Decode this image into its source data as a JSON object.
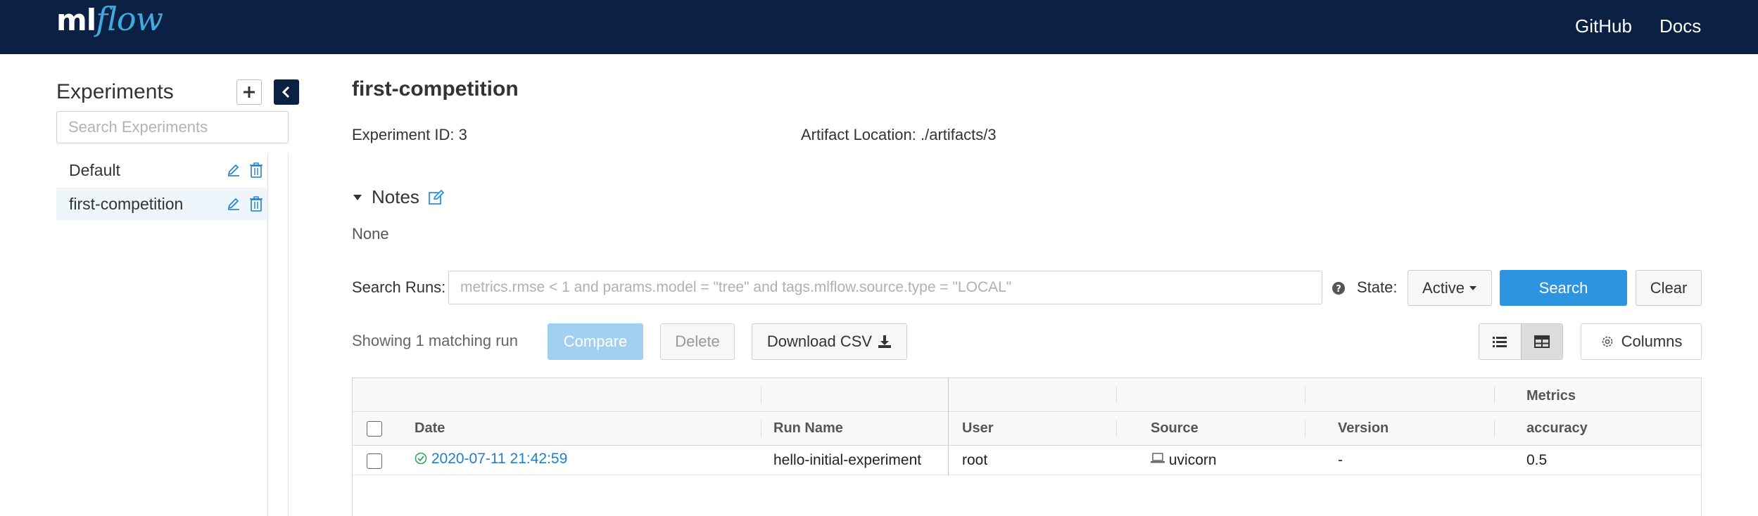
{
  "header": {
    "logo_ml": "ml",
    "logo_flow": "flow",
    "links": {
      "github": "GitHub",
      "docs": "Docs"
    }
  },
  "sidebar": {
    "title": "Experiments",
    "search_placeholder": "Search Experiments",
    "experiments": [
      {
        "name": "Default",
        "active": false
      },
      {
        "name": "first-competition",
        "active": true
      }
    ]
  },
  "experiment": {
    "title": "first-competition",
    "id_label": "Experiment ID:",
    "id_value": "3",
    "artifact_label": "Artifact Location:",
    "artifact_value": "./artifacts/3",
    "notes_label": "Notes",
    "notes_value": "None"
  },
  "search": {
    "label": "Search Runs:",
    "placeholder": "metrics.rmse < 1 and params.model = \"tree\" and tags.mlflow.source.type = \"LOCAL\"",
    "state_label": "State:",
    "state_value": "Active",
    "search_button": "Search",
    "clear_button": "Clear"
  },
  "toolbar": {
    "showing_text": "Showing 1 matching run",
    "compare_button": "Compare",
    "delete_button": "Delete",
    "csv_button": "Download CSV",
    "columns_button": "Columns"
  },
  "table": {
    "group_headers": {
      "metrics": "Metrics"
    },
    "columns": {
      "date": "Date",
      "run_name": "Run Name",
      "user": "User",
      "source": "Source",
      "version": "Version",
      "accuracy": "accuracy"
    },
    "rows": [
      {
        "date": "2020-07-11 21:42:59",
        "run_name": "hello-initial-experiment",
        "user": "root",
        "source": "uvicorn",
        "version": "-",
        "accuracy": "0.5"
      }
    ]
  },
  "colors": {
    "header_bg": "#0b2144",
    "logo_accent": "#43a7e0",
    "primary": "#2c95e1",
    "primary_disabled": "#a2d0f1",
    "link": "#1f7fc7",
    "success": "#2eaa5c"
  },
  "icons": {
    "add": "plus-icon",
    "collapse": "chevron-left-icon",
    "edit": "pencil-icon",
    "delete": "trash-icon",
    "help": "question-circle-icon",
    "caret": "caret-down-icon",
    "download": "download-icon",
    "list_view": "list-view-icon",
    "grid_view": "table-view-icon",
    "columns": "gear-icon",
    "status": "check-circle-icon",
    "source": "laptop-icon"
  }
}
